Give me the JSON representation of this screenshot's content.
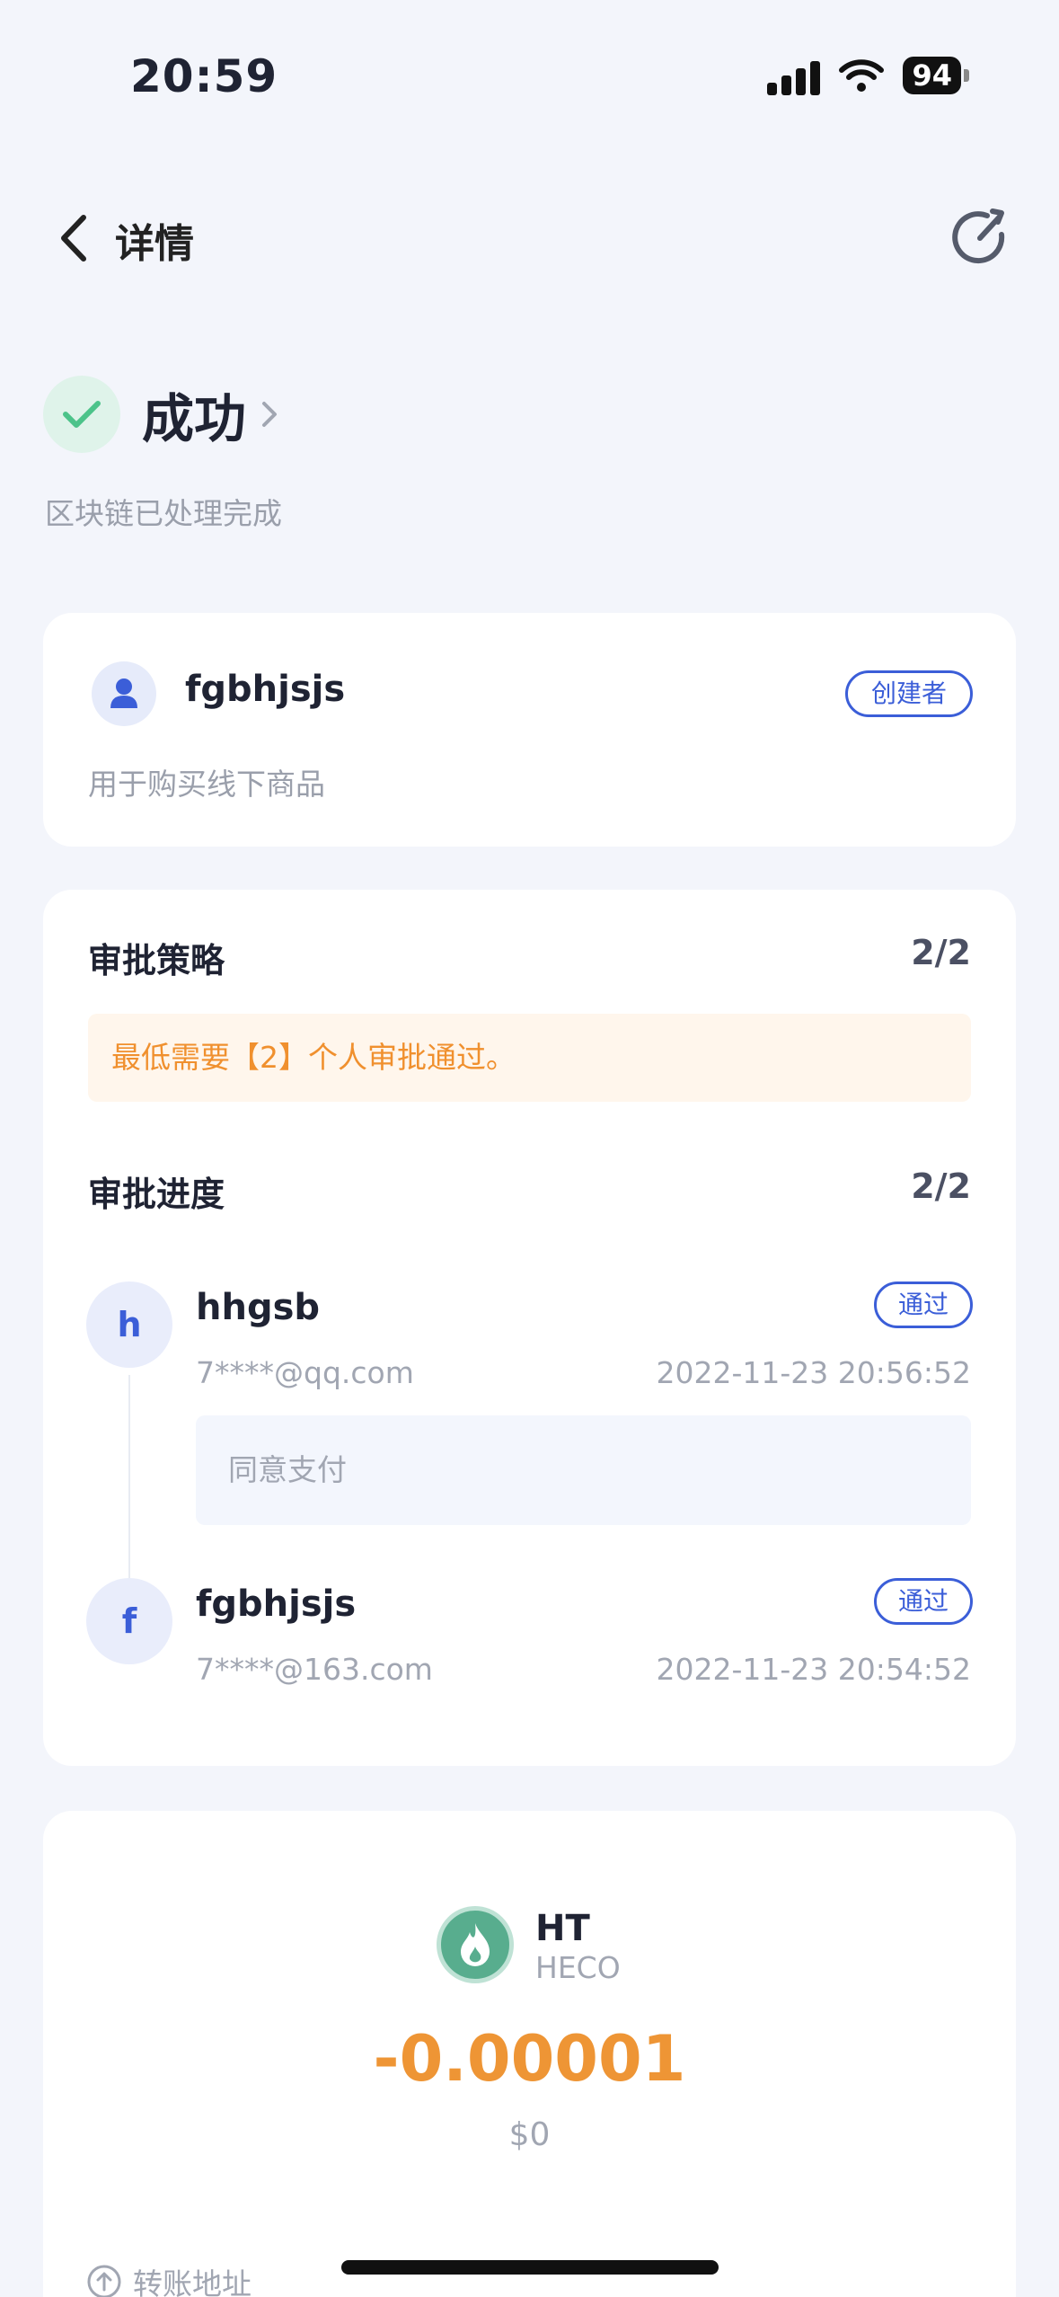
{
  "status_bar": {
    "time": "20:59",
    "battery": "94"
  },
  "header": {
    "title": "详情"
  },
  "status": {
    "label": "成功",
    "description": "区块链已处理完成"
  },
  "creator": {
    "name": "fgbhjsjs",
    "badge": "创建者",
    "note": "用于购买线下商品"
  },
  "approval": {
    "policy_title": "审批策略",
    "policy_count": "2/2",
    "notice": "最低需要【2】个人审批通过。",
    "progress_title": "审批进度",
    "progress_count": "2/2",
    "steps": [
      {
        "initial": "h",
        "name": "hhgsb",
        "badge": "通过",
        "email": "7****@qq.com",
        "time": "2022-11-23 20:56:52",
        "comment": "同意支付"
      },
      {
        "initial": "f",
        "name": "fgbhjsjs",
        "badge": "通过",
        "email": "7****@163.com",
        "time": "2022-11-23 20:54:52"
      }
    ]
  },
  "transaction": {
    "token": "HT",
    "chain": "HECO",
    "amount": "-0.00001",
    "usd": "$0",
    "transfer_label": "转账地址"
  },
  "colors": {
    "accent": "#3b5ed8",
    "success": "#4cc38a",
    "warning": "#f0902e",
    "amount": "#ee9535"
  }
}
